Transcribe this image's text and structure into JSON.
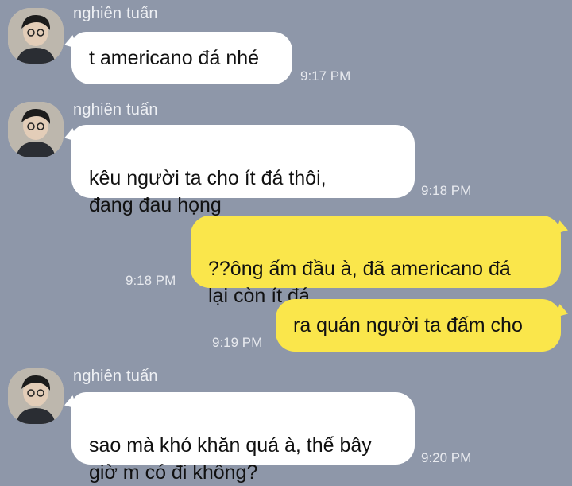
{
  "colors": {
    "background": "#8e97a9",
    "incoming_bubble": "#ffffff",
    "outgoing_bubble": "#fae64b",
    "text": "#111111",
    "meta_text": "#eef0f4"
  },
  "messages": [
    {
      "direction": "incoming",
      "sender": "nghiên tuấn",
      "text": "t americano đá nhé",
      "time": "9:17 PM"
    },
    {
      "direction": "incoming",
      "sender": "nghiên tuấn",
      "text": "kêu người ta cho ít đá thôi,\nđang đau họng",
      "time": "9:18 PM"
    },
    {
      "direction": "outgoing",
      "text": "??ông ấm đầu à, đã americano đá\nlại còn ít đá",
      "time": "9:18 PM"
    },
    {
      "direction": "outgoing",
      "text": "ra quán người ta đấm cho",
      "time": "9:19 PM"
    },
    {
      "direction": "incoming",
      "sender": "nghiên tuấn",
      "text": "sao mà khó khăn quá à, thế bây\ngiờ m có đi không?",
      "time": "9:20 PM"
    }
  ]
}
